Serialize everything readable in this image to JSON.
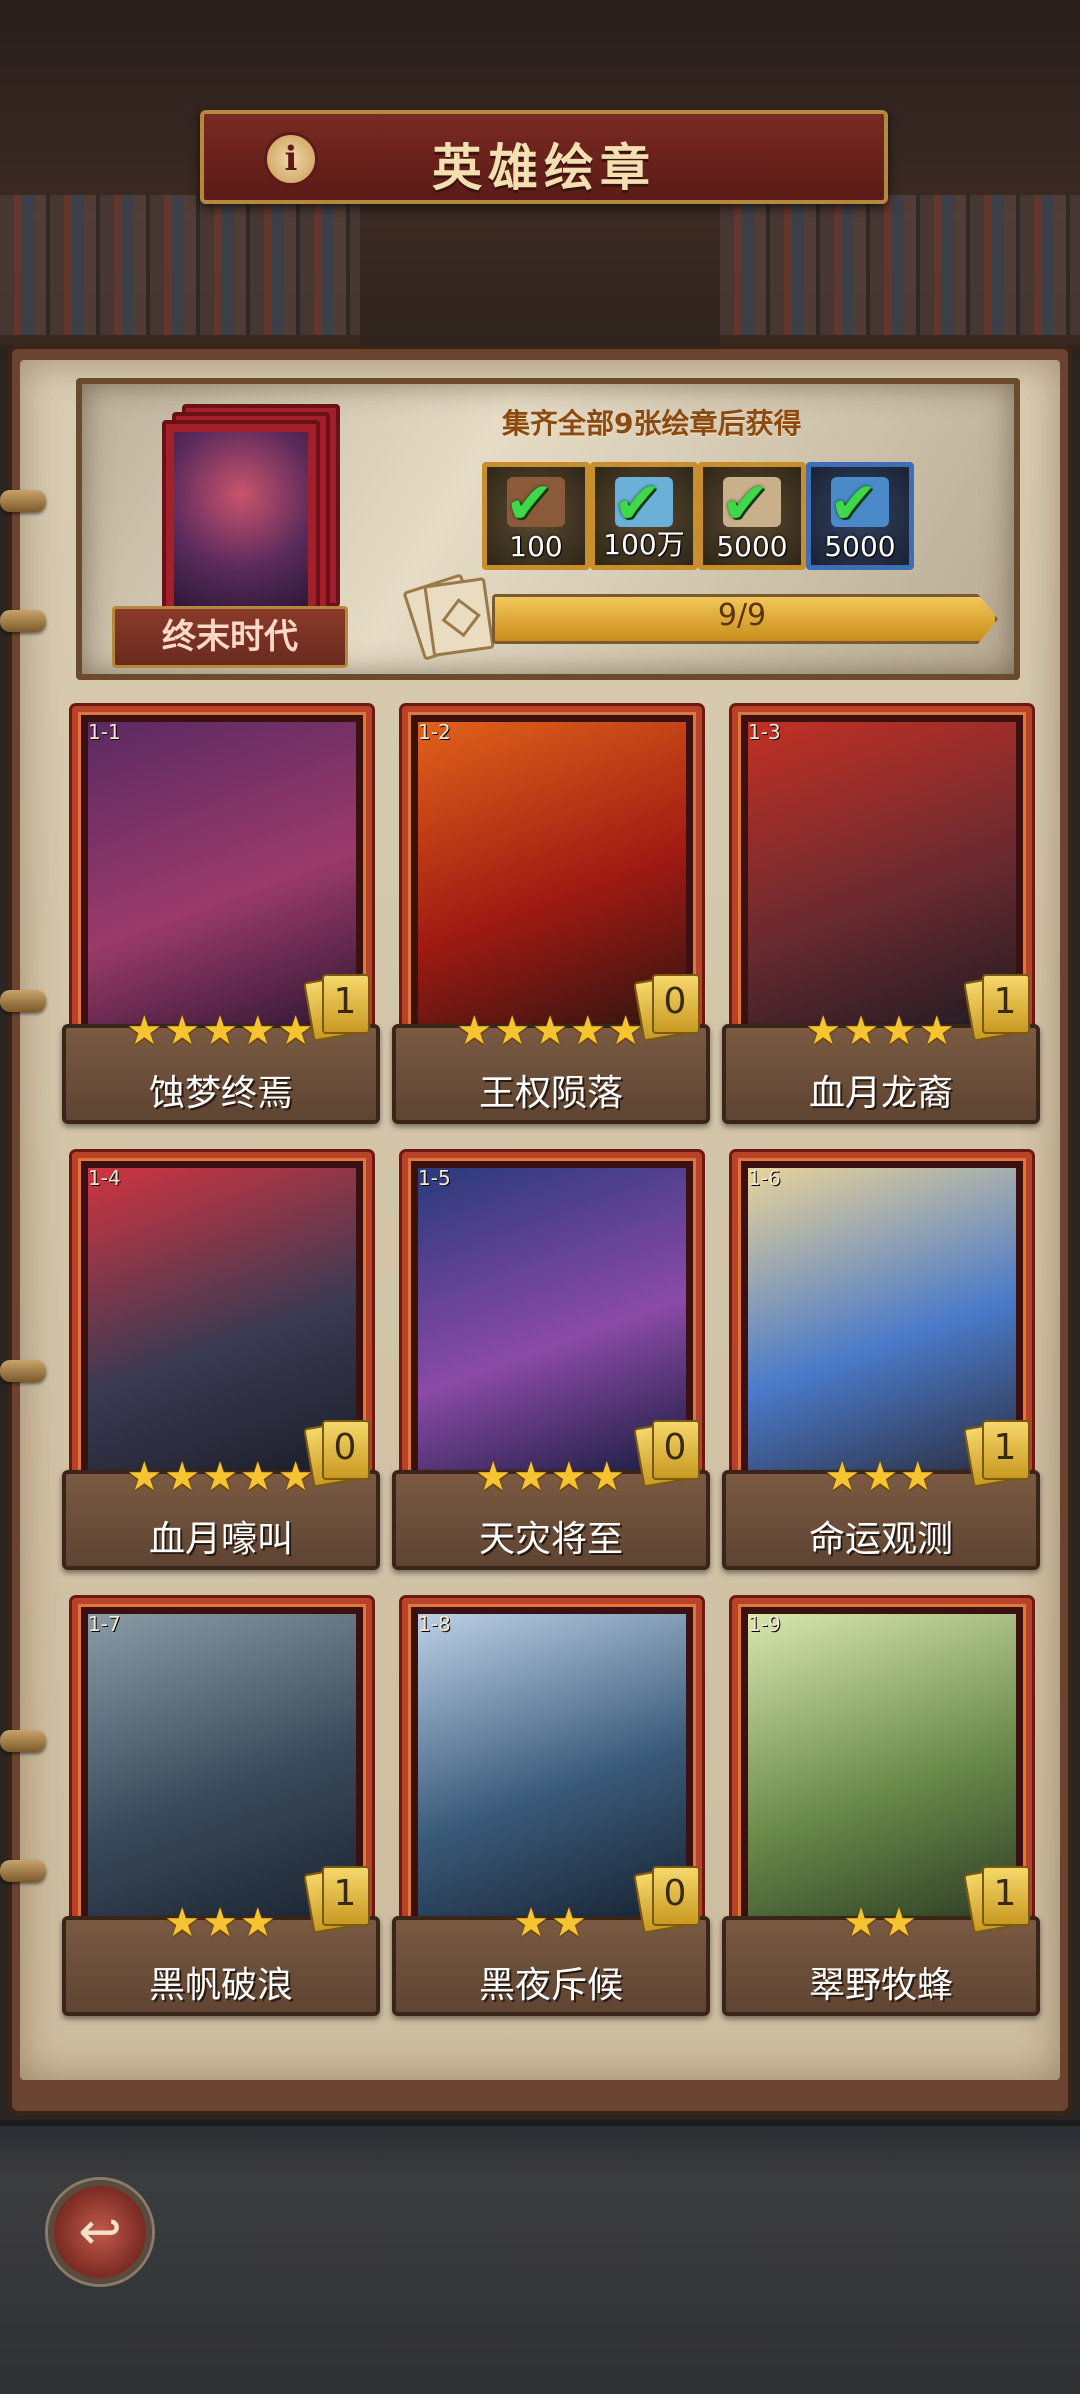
{
  "header": {
    "title": "英雄绘章",
    "info_icon": "ⅰ"
  },
  "album": {
    "name": "终末时代",
    "reward_title": "集齐全部9张绘章后获得",
    "rewards": [
      {
        "icon": "hammer-icon",
        "amount": "100",
        "claimed": true,
        "color": "#c98e2c"
      },
      {
        "icon": "crystal-icon",
        "amount": "100万",
        "claimed": true,
        "color": "#c98e2c"
      },
      {
        "icon": "scroll-icon",
        "amount": "5000",
        "claimed": true,
        "color": "#c98e2c"
      },
      {
        "icon": "star-shard-icon",
        "amount": "5000",
        "claimed": true,
        "color": "#3e6fb6"
      }
    ],
    "progress_text": "9/9",
    "progress_value": 1.0
  },
  "cards": [
    {
      "id": "1-1",
      "name": "蚀梦终焉",
      "stars": "★★★★★",
      "count": "1",
      "art_colors": [
        "#5b2a62",
        "#9a3a6a",
        "#2a1630"
      ]
    },
    {
      "id": "1-2",
      "name": "王权陨落",
      "stars": "★★★★★",
      "count": "0",
      "art_colors": [
        "#e0621a",
        "#a01a12",
        "#2a1410"
      ]
    },
    {
      "id": "1-3",
      "name": "血月龙裔",
      "stars": "★★★★",
      "count": "1",
      "art_colors": [
        "#c23024",
        "#6a2a30",
        "#1e1a22"
      ]
    },
    {
      "id": "1-4",
      "name": "血月嚎叫",
      "stars": "★★★★★",
      "count": "0",
      "art_colors": [
        "#d03440",
        "#3a3a52",
        "#1a1c26"
      ]
    },
    {
      "id": "1-5",
      "name": "天灾将至",
      "stars": "★★★★",
      "count": "0",
      "art_colors": [
        "#2a3a7a",
        "#8a4aa6",
        "#121a3a"
      ]
    },
    {
      "id": "1-6",
      "name": "命运观测",
      "stars": "★★★",
      "count": "1",
      "art_colors": [
        "#e8d39a",
        "#4a7ac8",
        "#2a2a3a"
      ]
    },
    {
      "id": "1-7",
      "name": "黑帆破浪",
      "stars": "★★★",
      "count": "1",
      "art_colors": [
        "#8a9aa6",
        "#3a4a5a",
        "#1a2230"
      ]
    },
    {
      "id": "1-8",
      "name": "黑夜斥候",
      "stars": "★★",
      "count": "0",
      "art_colors": [
        "#bcd0e6",
        "#3a5a7a",
        "#16202e"
      ]
    },
    {
      "id": "1-9",
      "name": "翠野牧蜂",
      "stars": "★★",
      "count": "1",
      "art_colors": [
        "#d8e6b0",
        "#6a8a4a",
        "#2a3a22"
      ]
    }
  ],
  "footer": {
    "back_icon": "↩"
  }
}
